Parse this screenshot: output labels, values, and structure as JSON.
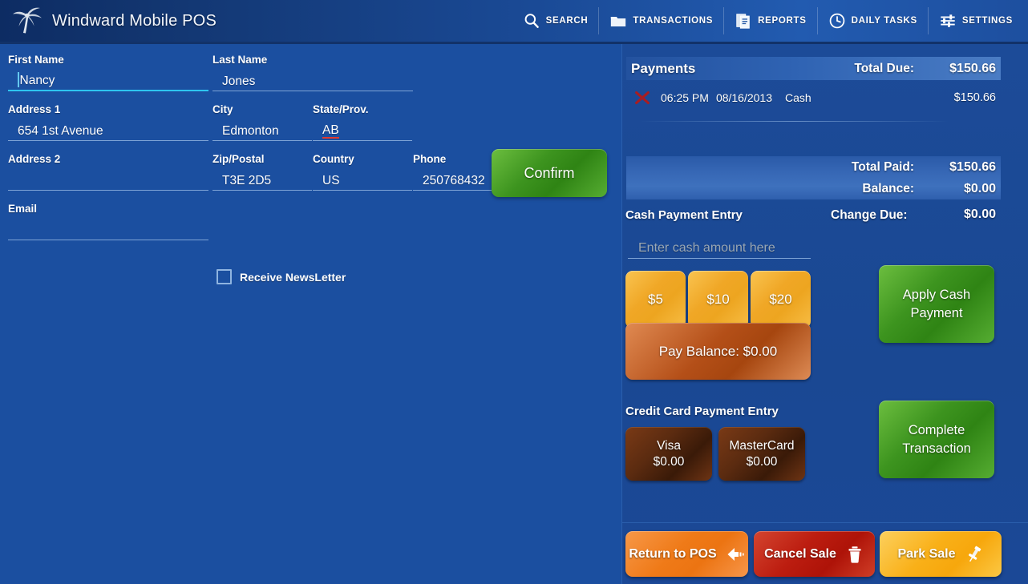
{
  "app": {
    "title": "Windward Mobile POS",
    "logo_icon": "palm-tree-icon"
  },
  "nav": {
    "items": [
      {
        "label": "SEARCH",
        "icon": "search-icon"
      },
      {
        "label": "TRANSACTIONS",
        "icon": "folder-icon"
      },
      {
        "label": "REPORTS",
        "icon": "documents-icon"
      },
      {
        "label": "DAILY TASKS",
        "icon": "clock-icon"
      },
      {
        "label": "SETTINGS",
        "icon": "sliders-icon"
      }
    ]
  },
  "customer_form": {
    "first_name": {
      "label": "First Name",
      "value": "Nancy",
      "focused": true
    },
    "last_name": {
      "label": "Last Name",
      "value": "Jones"
    },
    "address1": {
      "label": "Address 1",
      "value": "654 1st Avenue"
    },
    "city": {
      "label": "City",
      "value": "Edmonton"
    },
    "state": {
      "label": "State/Prov.",
      "value": "AB",
      "spellcheck_flag": true
    },
    "address2": {
      "label": "Address 2",
      "value": ""
    },
    "zip": {
      "label": "Zip/Postal",
      "value": "T3E 2D5"
    },
    "country": {
      "label": "Country",
      "value": "US"
    },
    "phone": {
      "label": "Phone",
      "value": "250768432"
    },
    "email": {
      "label": "Email",
      "value": ""
    },
    "newsletter": {
      "label": "Receive NewsLetter",
      "checked": false
    },
    "confirm_label": "Confirm"
  },
  "payments": {
    "title": "Payments",
    "total_due_label": "Total Due:",
    "total_due_value": "$150.66",
    "rows": [
      {
        "delete_icon": "red-x-icon",
        "time": "06:25 PM",
        "date": "08/16/2013",
        "type": "Cash",
        "amount": "$150.66"
      }
    ],
    "total_paid_label": "Total Paid:",
    "total_paid_value": "$150.66",
    "balance_label": "Balance:",
    "balance_value": "$0.00"
  },
  "cash_entry": {
    "title": "Cash Payment Entry",
    "change_due_label": "Change Due:",
    "change_due_value": "$0.00",
    "input_placeholder": "Enter cash amount here",
    "input_value": "",
    "denominations": [
      {
        "label": "$5"
      },
      {
        "label": "$10"
      },
      {
        "label": "$20"
      }
    ],
    "pay_balance_label": "Pay Balance: $0.00",
    "apply_cash_line1": "Apply Cash",
    "apply_cash_line2": "Payment"
  },
  "credit_card_entry": {
    "title": "Credit Card Payment Entry",
    "cards": [
      {
        "name": "Visa",
        "amount": "$0.00"
      },
      {
        "name": "MasterCard",
        "amount": "$0.00"
      }
    ],
    "complete_line1": "Complete",
    "complete_line2": "Transaction"
  },
  "bottom_actions": [
    {
      "label": "Return to POS",
      "icon": "back-arrow-icon"
    },
    {
      "label": "Cancel Sale",
      "icon": "trash-icon"
    },
    {
      "label": "Park Sale",
      "icon": "pushpin-icon"
    }
  ],
  "colors": {
    "background_blue": "#1b4fa0",
    "header_blue": "#143a7e",
    "accent_green": "#3d941f",
    "accent_orange": "#f0a726",
    "accent_red": "#bc1d10",
    "accent_yellow": "#f9b018",
    "card_brown": "#5b2b10",
    "focus_cyan": "#2ec5f0"
  }
}
